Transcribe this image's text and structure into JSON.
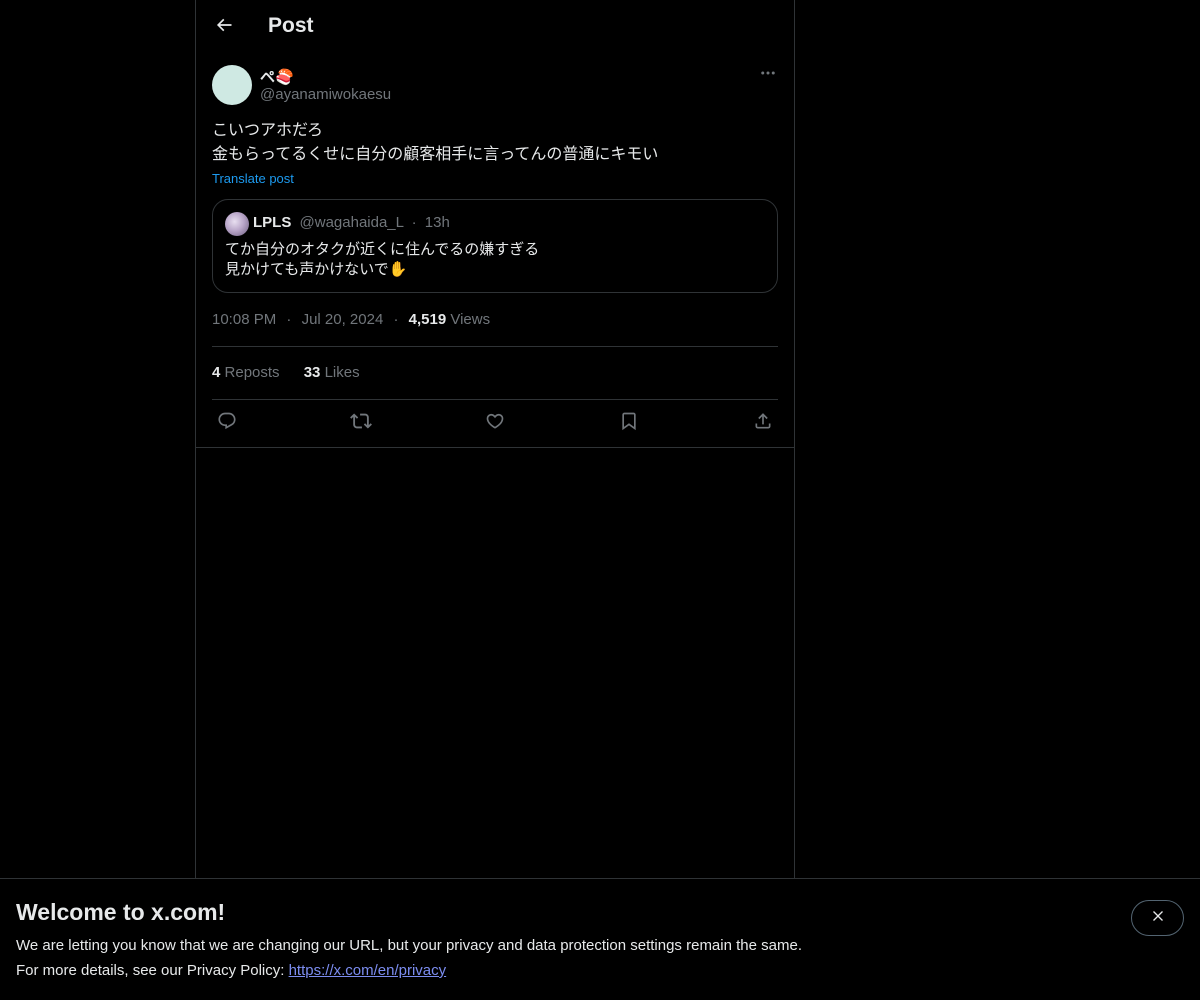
{
  "header": {
    "title": "Post"
  },
  "post": {
    "author_name": "ペ🍣",
    "author_handle": "@ayanamiwokaesu",
    "text": "こいつアホだろ\n金もらってるくせに自分の顧客相手に言ってんの普通にキモい",
    "translate_label": "Translate post",
    "time": "10:08 PM",
    "date": "Jul 20, 2024",
    "views_count": "4,519",
    "views_label": "Views",
    "reposts_count": "4",
    "reposts_label": "Reposts",
    "likes_count": "33",
    "likes_label": "Likes"
  },
  "quote": {
    "author_name": "LPLS",
    "author_handle": "@wagahaida_L",
    "separator": "·",
    "time": "13h",
    "text": "てか自分のオタクが近くに住んでるの嫌すぎる\n見かけても声かけないで✋"
  },
  "meta_separator": "·",
  "actions": {
    "icons": [
      "reply-icon",
      "repost-icon",
      "like-icon",
      "bookmark-icon",
      "share-icon"
    ]
  },
  "banner": {
    "title": "Welcome to x.com!",
    "line1": "We are letting you know that we are changing our URL, but your privacy and data protection settings remain the same.",
    "line2_prefix": "For more details, see our Privacy Policy: ",
    "link_text": "https://x.com/en/privacy"
  },
  "colors": {
    "background": "#000000",
    "text_primary": "#e7e9ea",
    "text_secondary": "#71767b",
    "accent": "#1d9bf0",
    "border": "#2f3336",
    "link_banner": "#7c8df0"
  }
}
